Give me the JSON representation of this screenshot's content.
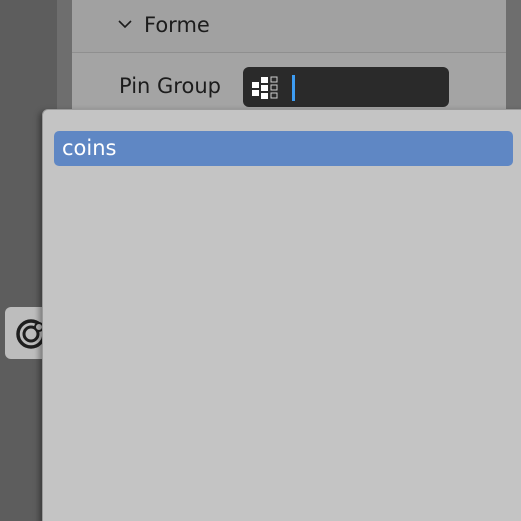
{
  "properties": {
    "section_title": "Forme",
    "pin_group_label": "Pin Group",
    "pin_group_value": ""
  },
  "dropdown": {
    "items": [
      {
        "label": "coins",
        "selected": true
      }
    ]
  },
  "icons": {
    "section_toggle": "chevron-down-icon",
    "pin_group": "vertex-group-icon",
    "side_tool": "cycles-render-icon"
  },
  "colors": {
    "selected_item": "#5f87c4",
    "text_cursor": "#3d9cf2",
    "dropdown_bg": "#c4c4c4"
  }
}
